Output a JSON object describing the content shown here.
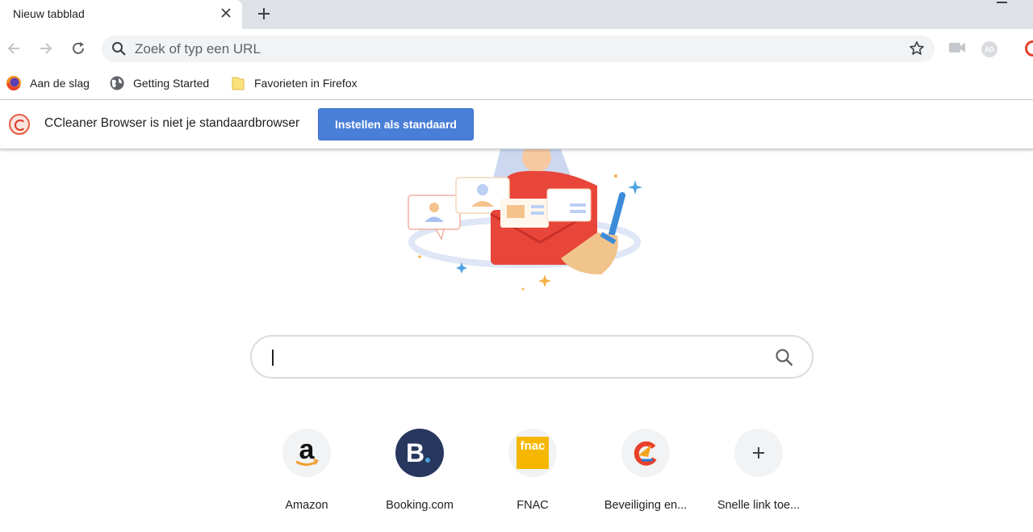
{
  "tab": {
    "title": "Nieuw tabblad",
    "close_icon": "close-icon"
  },
  "toolbar": {
    "omnibox_placeholder": "Zoek of typ een URL",
    "avatar_initials": "AD"
  },
  "bookmarks": [
    {
      "label": "Aan de slag",
      "icon": "firefox-icon"
    },
    {
      "label": "Getting Started",
      "icon": "globe-icon"
    },
    {
      "label": "Favorieten in Firefox",
      "icon": "folder-icon"
    }
  ],
  "infobar": {
    "message": "CCleaner Browser is niet je standaardbrowser",
    "button_label": "Instellen als standaard",
    "accent": "#4a7fd8"
  },
  "shortcuts": [
    {
      "label": "Amazon",
      "icon": "amazon-icon"
    },
    {
      "label": "Booking.com",
      "icon": "booking-icon",
      "letter": "B"
    },
    {
      "label": "FNAC",
      "icon": "fnac-icon",
      "badge": "fnac"
    },
    {
      "label": "Beveiliging en...",
      "icon": "ccleaner-icon"
    },
    {
      "label": "Snelle link toe...",
      "icon": "plus-icon"
    }
  ],
  "colors": {
    "tabstrip": "#dee1e6",
    "omnibox": "#f1f3f4",
    "booking": "#27375e",
    "fnac": "#f5b700"
  }
}
